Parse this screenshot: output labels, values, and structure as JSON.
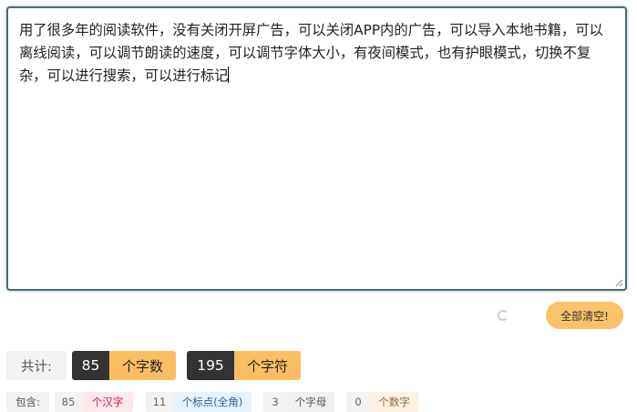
{
  "editor": {
    "text": "用了很多年的阅读软件，没有关闭开屏广告，可以关闭APP内的广告，可以导入本地书籍，可以离线阅读，可以调节朗读的速度，可以调节字体大小，有夜间模式，也有护眼模式，切换不复杂，可以进行搜索，可以进行标记"
  },
  "actions": {
    "clear_label": "全部清空!"
  },
  "totals": {
    "label": "共计:",
    "word_count": "85",
    "word_label": "个字数",
    "char_count": "195",
    "char_label": "个字符"
  },
  "contains": {
    "label": "包含:",
    "items": [
      {
        "count": "85",
        "label": "个汉字"
      },
      {
        "count": "11",
        "label": "个标点(全角)"
      },
      {
        "count": "3",
        "label": "个字母"
      },
      {
        "count": "0",
        "label": "个数字"
      }
    ]
  },
  "colors": {
    "accent": "#fcc26a",
    "dark": "#333333",
    "border": "#4a6a74"
  }
}
